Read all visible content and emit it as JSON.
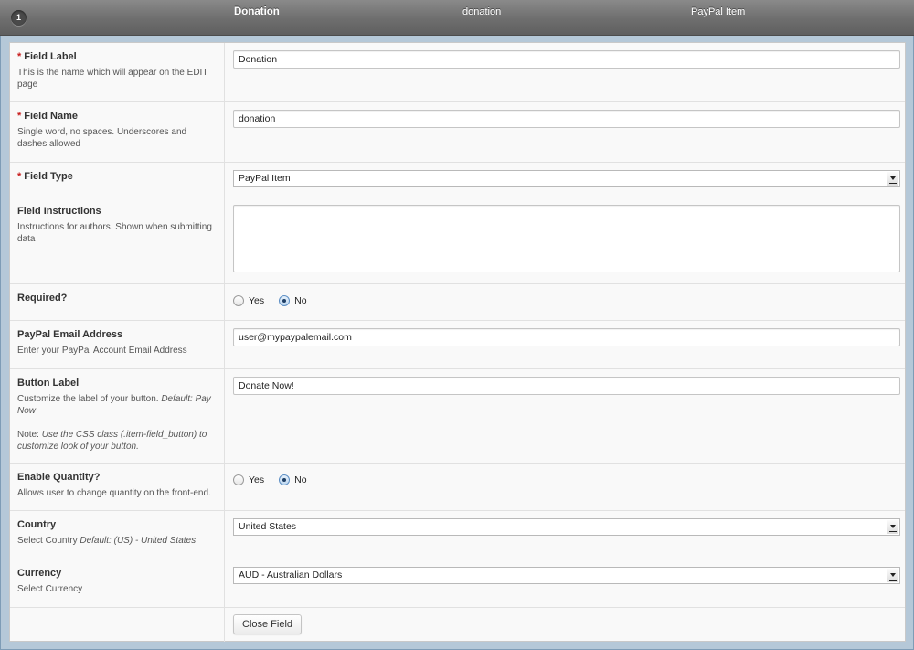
{
  "header": {
    "order": "1",
    "label": "Donation",
    "name": "donation",
    "type": "PayPal Item"
  },
  "fields": {
    "field_label": {
      "required_mark": "*",
      "title": "Field Label",
      "desc": "This is the name which will appear on the EDIT page",
      "value": "Donation"
    },
    "field_name": {
      "required_mark": "*",
      "title": "Field Name",
      "desc": "Single word, no spaces. Underscores and dashes allowed",
      "value": "donation"
    },
    "field_type": {
      "required_mark": "*",
      "title": "Field Type",
      "selected": "PayPal Item"
    },
    "field_instructions": {
      "title": "Field Instructions",
      "desc": "Instructions for authors. Shown when submitting data",
      "value": ""
    },
    "required": {
      "title": "Required?",
      "options": [
        "Yes",
        "No"
      ],
      "selected": "No"
    },
    "paypal_email": {
      "title": "PayPal Email Address",
      "desc": "Enter your PayPal Account Email Address",
      "value": "user@mypaypalemail.com"
    },
    "button_label": {
      "title": "Button Label",
      "desc": "Customize the label of your button. ",
      "desc_default": "Default: Pay Now",
      "note_prefix": "Note: ",
      "note": "Use the CSS class (.item-field_button) to customize look of your button.",
      "value": "Donate Now!"
    },
    "enable_quantity": {
      "title": "Enable Quantity?",
      "desc": "Allows user to change quantity on the front-end.",
      "options": [
        "Yes",
        "No"
      ],
      "selected": "No"
    },
    "country": {
      "title": "Country",
      "desc": "Select Country ",
      "desc_default": "Default: (US) - United States",
      "selected": "United States"
    },
    "currency": {
      "title": "Currency",
      "desc": "Select Currency",
      "selected": "AUD - Australian Dollars"
    }
  },
  "close_button": "Close Field"
}
